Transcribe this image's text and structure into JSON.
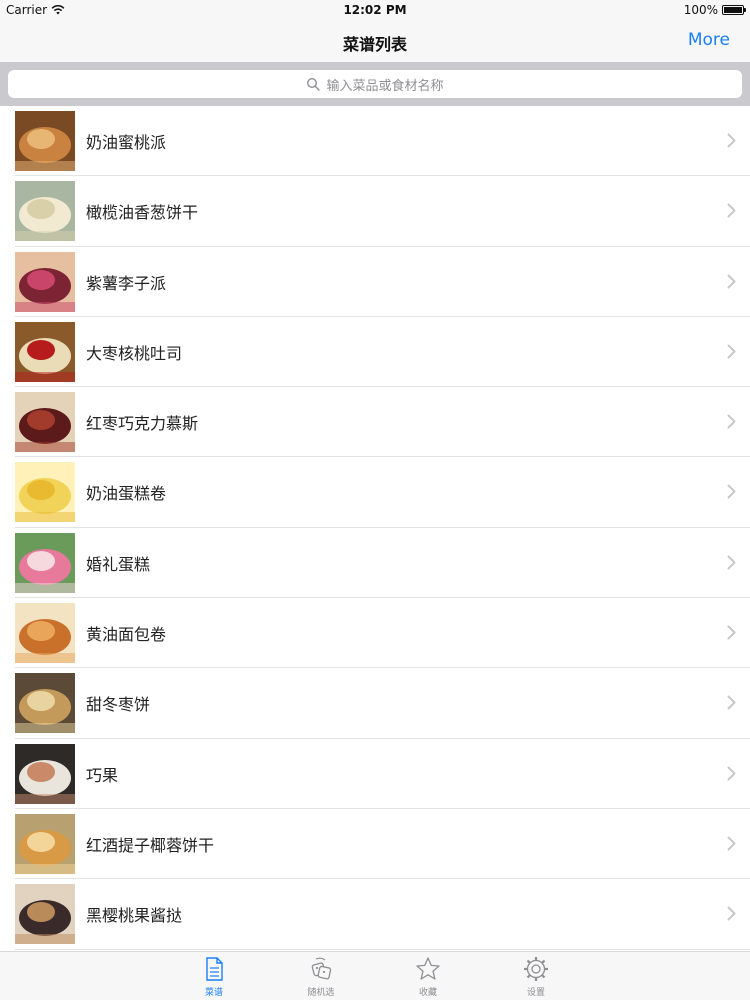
{
  "status_bar": {
    "carrier": "Carrier",
    "time": "12:02 PM",
    "battery": "100%"
  },
  "nav": {
    "title": "菜谱列表",
    "more_label": "More"
  },
  "search": {
    "placeholder": "输入菜品或食材名称"
  },
  "recipes": [
    {
      "name": "奶油蜜桃派",
      "thumb_colors": [
        "#c9823f",
        "#e7b675",
        "#7a4a25"
      ]
    },
    {
      "name": "橄榄油香葱饼干",
      "thumb_colors": [
        "#f1ead1",
        "#d9cfa9",
        "#a9b7a2"
      ]
    },
    {
      "name": "紫薯李子派",
      "thumb_colors": [
        "#7c2334",
        "#c9466a",
        "#e6bfa0"
      ]
    },
    {
      "name": "大枣核桃吐司",
      "thumb_colors": [
        "#eadcb6",
        "#b71c1c",
        "#8b5a2b"
      ]
    },
    {
      "name": "红枣巧克力慕斯",
      "thumb_colors": [
        "#5d1a1a",
        "#a33b2c",
        "#e5d3b9"
      ]
    },
    {
      "name": "奶油蛋糕卷",
      "thumb_colors": [
        "#f2d35a",
        "#e9b92f",
        "#fff1b8"
      ]
    },
    {
      "name": "婚礼蛋糕",
      "thumb_colors": [
        "#e77a9a",
        "#f6d8df",
        "#6a9b5a"
      ]
    },
    {
      "name": "黄油面包卷",
      "thumb_colors": [
        "#c9712b",
        "#e9a65a",
        "#f3e3c3"
      ]
    },
    {
      "name": "甜冬枣饼",
      "thumb_colors": [
        "#c49a5a",
        "#e8d3a1",
        "#5b4a37"
      ]
    },
    {
      "name": "巧果",
      "thumb_colors": [
        "#e9e4dc",
        "#c98a6a",
        "#2e2a28"
      ]
    },
    {
      "name": "红酒提子椰蓉饼干",
      "thumb_colors": [
        "#d99a45",
        "#f3d59a",
        "#b9a070"
      ]
    },
    {
      "name": "黑樱桃果酱挞",
      "thumb_colors": [
        "#3a2a2a",
        "#b98a5a",
        "#e2d3c1"
      ]
    }
  ],
  "tabs": [
    {
      "label": "菜谱",
      "icon": "recipe-doc-icon",
      "active": true
    },
    {
      "label": "随机选",
      "icon": "random-dice-icon",
      "active": false
    },
    {
      "label": "收藏",
      "icon": "star-icon",
      "active": false
    },
    {
      "label": "设置",
      "icon": "gear-icon",
      "active": false
    }
  ],
  "colors": {
    "accent": "#1a7ef7",
    "inactive": "#8e8e93"
  }
}
